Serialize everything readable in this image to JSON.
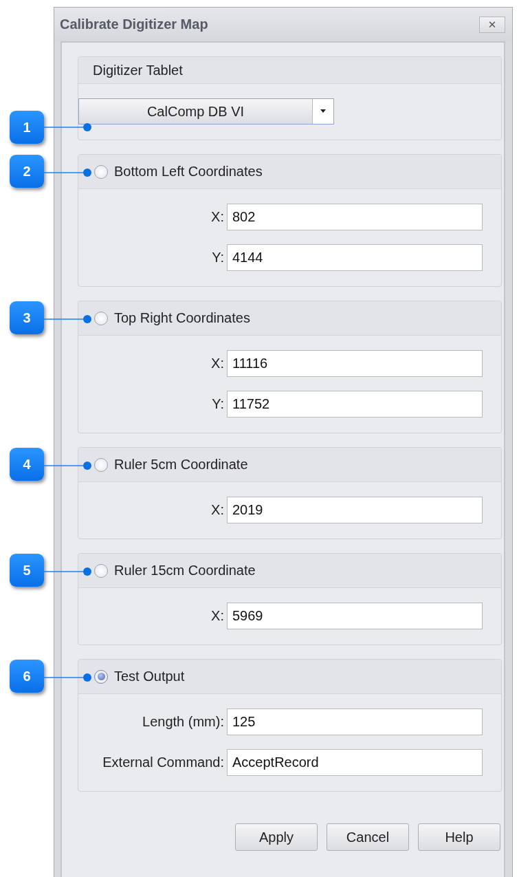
{
  "window": {
    "title": "Calibrate Digitizer Map",
    "close": "✕"
  },
  "groups": [
    {
      "kind": "dropdown",
      "callout": "1",
      "title": "Digitizer Tablet",
      "value": "CalComp DB VI"
    },
    {
      "kind": "radio",
      "callout": "2",
      "title": "Bottom Left Coordinates",
      "selected": false,
      "fields": [
        {
          "label": "X:",
          "value": "802"
        },
        {
          "label": "Y:",
          "value": "4144"
        }
      ]
    },
    {
      "kind": "radio",
      "callout": "3",
      "title": "Top Right Coordinates",
      "selected": false,
      "fields": [
        {
          "label": "X:",
          "value": "11116"
        },
        {
          "label": "Y:",
          "value": "11752"
        }
      ]
    },
    {
      "kind": "radio",
      "callout": "4",
      "title": "Ruler 5cm Coordinate",
      "selected": false,
      "fields": [
        {
          "label": "X:",
          "value": "2019"
        }
      ]
    },
    {
      "kind": "radio",
      "callout": "5",
      "title": "Ruler 15cm Coordinate",
      "selected": false,
      "fields": [
        {
          "label": "X:",
          "value": "5969"
        }
      ]
    },
    {
      "kind": "radio",
      "callout": "6",
      "title": "Test Output",
      "selected": true,
      "fields": [
        {
          "label": "Length (mm):",
          "value": "125"
        },
        {
          "label": "External Command:",
          "value": "AcceptRecord"
        }
      ]
    }
  ],
  "buttons": [
    "Apply",
    "Cancel",
    "Help"
  ]
}
